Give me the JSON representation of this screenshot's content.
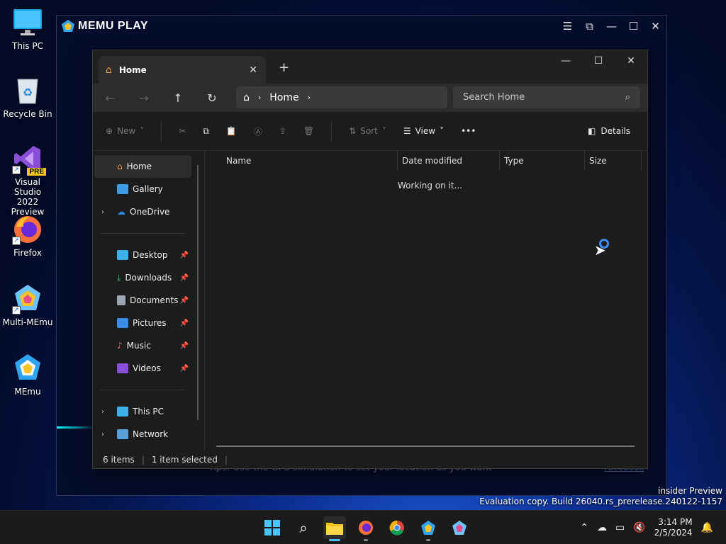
{
  "desktop": {
    "icons": [
      {
        "label": "This PC"
      },
      {
        "label": "Recycle Bin"
      },
      {
        "label_line1": "Visual Studio",
        "label_line2": "2022 Preview",
        "badge": "PRE"
      },
      {
        "label": "Firefox"
      },
      {
        "label": "Multi-MEmu"
      },
      {
        "label": "MEmu"
      }
    ]
  },
  "memu": {
    "logo_text": "MEMU PLAY",
    "tips": "Tips: Use the GPS simulation to set your location as you want",
    "link": "Facebook"
  },
  "explorer": {
    "tab_title": "Home",
    "breadcrumb": "Home",
    "search_placeholder": "Search Home",
    "commands": {
      "new": "New",
      "sort": "Sort",
      "view": "View",
      "more": "•••",
      "details": "Details"
    },
    "nav": {
      "home": "Home",
      "gallery": "Gallery",
      "onedrive": "OneDrive",
      "desktop": "Desktop",
      "downloads": "Downloads",
      "documents": "Documents",
      "pictures": "Pictures",
      "music": "Music",
      "videos": "Videos",
      "thispc": "This PC",
      "network": "Network"
    },
    "columns": {
      "name": "Name",
      "date": "Date modified",
      "type": "Type",
      "size": "Size"
    },
    "working": "Working on it...",
    "status": {
      "items": "6 items",
      "selected": "1 item selected"
    }
  },
  "watermark": {
    "line1": "insider Preview",
    "line2": "Evaluation copy. Build 26040.rs_prerelease.240122-1157"
  },
  "taskbar": {
    "time": "3:14 PM",
    "date": "2/5/2024"
  },
  "colors": {
    "accent": "#4cc2ff",
    "spinner": "#3b8cff"
  }
}
